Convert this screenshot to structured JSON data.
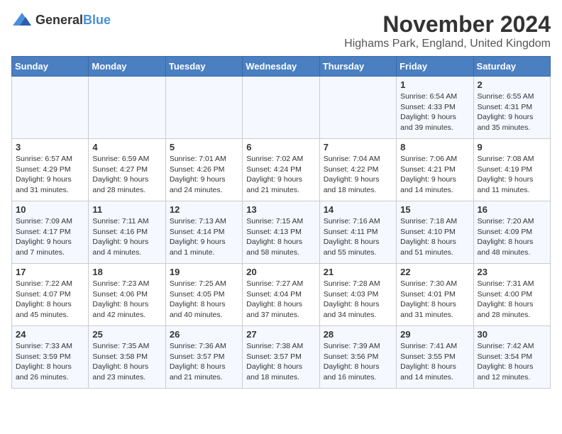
{
  "logo": {
    "general": "General",
    "blue": "Blue"
  },
  "title": "November 2024",
  "location": "Highams Park, England, United Kingdom",
  "weekdays": [
    "Sunday",
    "Monday",
    "Tuesday",
    "Wednesday",
    "Thursday",
    "Friday",
    "Saturday"
  ],
  "weeks": [
    [
      {
        "day": "",
        "info": ""
      },
      {
        "day": "",
        "info": ""
      },
      {
        "day": "",
        "info": ""
      },
      {
        "day": "",
        "info": ""
      },
      {
        "day": "",
        "info": ""
      },
      {
        "day": "1",
        "info": "Sunrise: 6:54 AM\nSunset: 4:33 PM\nDaylight: 9 hours and 39 minutes."
      },
      {
        "day": "2",
        "info": "Sunrise: 6:55 AM\nSunset: 4:31 PM\nDaylight: 9 hours and 35 minutes."
      }
    ],
    [
      {
        "day": "3",
        "info": "Sunrise: 6:57 AM\nSunset: 4:29 PM\nDaylight: 9 hours and 31 minutes."
      },
      {
        "day": "4",
        "info": "Sunrise: 6:59 AM\nSunset: 4:27 PM\nDaylight: 9 hours and 28 minutes."
      },
      {
        "day": "5",
        "info": "Sunrise: 7:01 AM\nSunset: 4:26 PM\nDaylight: 9 hours and 24 minutes."
      },
      {
        "day": "6",
        "info": "Sunrise: 7:02 AM\nSunset: 4:24 PM\nDaylight: 9 hours and 21 minutes."
      },
      {
        "day": "7",
        "info": "Sunrise: 7:04 AM\nSunset: 4:22 PM\nDaylight: 9 hours and 18 minutes."
      },
      {
        "day": "8",
        "info": "Sunrise: 7:06 AM\nSunset: 4:21 PM\nDaylight: 9 hours and 14 minutes."
      },
      {
        "day": "9",
        "info": "Sunrise: 7:08 AM\nSunset: 4:19 PM\nDaylight: 9 hours and 11 minutes."
      }
    ],
    [
      {
        "day": "10",
        "info": "Sunrise: 7:09 AM\nSunset: 4:17 PM\nDaylight: 9 hours and 7 minutes."
      },
      {
        "day": "11",
        "info": "Sunrise: 7:11 AM\nSunset: 4:16 PM\nDaylight: 9 hours and 4 minutes."
      },
      {
        "day": "12",
        "info": "Sunrise: 7:13 AM\nSunset: 4:14 PM\nDaylight: 9 hours and 1 minute."
      },
      {
        "day": "13",
        "info": "Sunrise: 7:15 AM\nSunset: 4:13 PM\nDaylight: 8 hours and 58 minutes."
      },
      {
        "day": "14",
        "info": "Sunrise: 7:16 AM\nSunset: 4:11 PM\nDaylight: 8 hours and 55 minutes."
      },
      {
        "day": "15",
        "info": "Sunrise: 7:18 AM\nSunset: 4:10 PM\nDaylight: 8 hours and 51 minutes."
      },
      {
        "day": "16",
        "info": "Sunrise: 7:20 AM\nSunset: 4:09 PM\nDaylight: 8 hours and 48 minutes."
      }
    ],
    [
      {
        "day": "17",
        "info": "Sunrise: 7:22 AM\nSunset: 4:07 PM\nDaylight: 8 hours and 45 minutes."
      },
      {
        "day": "18",
        "info": "Sunrise: 7:23 AM\nSunset: 4:06 PM\nDaylight: 8 hours and 42 minutes."
      },
      {
        "day": "19",
        "info": "Sunrise: 7:25 AM\nSunset: 4:05 PM\nDaylight: 8 hours and 40 minutes."
      },
      {
        "day": "20",
        "info": "Sunrise: 7:27 AM\nSunset: 4:04 PM\nDaylight: 8 hours and 37 minutes."
      },
      {
        "day": "21",
        "info": "Sunrise: 7:28 AM\nSunset: 4:03 PM\nDaylight: 8 hours and 34 minutes."
      },
      {
        "day": "22",
        "info": "Sunrise: 7:30 AM\nSunset: 4:01 PM\nDaylight: 8 hours and 31 minutes."
      },
      {
        "day": "23",
        "info": "Sunrise: 7:31 AM\nSunset: 4:00 PM\nDaylight: 8 hours and 28 minutes."
      }
    ],
    [
      {
        "day": "24",
        "info": "Sunrise: 7:33 AM\nSunset: 3:59 PM\nDaylight: 8 hours and 26 minutes."
      },
      {
        "day": "25",
        "info": "Sunrise: 7:35 AM\nSunset: 3:58 PM\nDaylight: 8 hours and 23 minutes."
      },
      {
        "day": "26",
        "info": "Sunrise: 7:36 AM\nSunset: 3:57 PM\nDaylight: 8 hours and 21 minutes."
      },
      {
        "day": "27",
        "info": "Sunrise: 7:38 AM\nSunset: 3:57 PM\nDaylight: 8 hours and 18 minutes."
      },
      {
        "day": "28",
        "info": "Sunrise: 7:39 AM\nSunset: 3:56 PM\nDaylight: 8 hours and 16 minutes."
      },
      {
        "day": "29",
        "info": "Sunrise: 7:41 AM\nSunset: 3:55 PM\nDaylight: 8 hours and 14 minutes."
      },
      {
        "day": "30",
        "info": "Sunrise: 7:42 AM\nSunset: 3:54 PM\nDaylight: 8 hours and 12 minutes."
      }
    ]
  ]
}
